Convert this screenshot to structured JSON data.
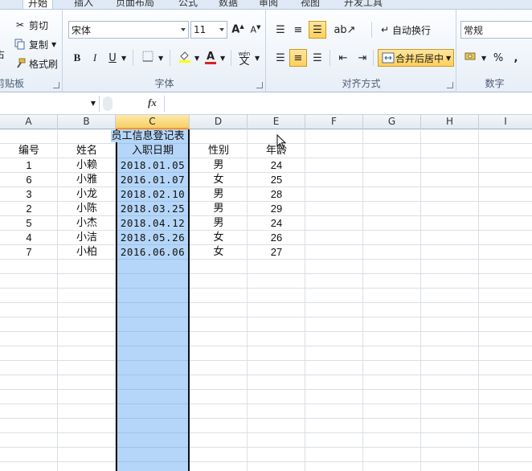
{
  "ribbon": {
    "tabs": [
      "开始",
      "插入",
      "页面布局",
      "公式",
      "数据",
      "审阅",
      "视图",
      "开发工具"
    ],
    "clipboard": {
      "cut": "剪切",
      "copy": "复制",
      "format_painter": "格式刷",
      "paste_partial": "占",
      "group_label": "剪贴板"
    },
    "font": {
      "font_name": "宋体",
      "font_size": "11",
      "bold": "B",
      "italic": "I",
      "underline": "U",
      "group_label": "字体",
      "phonetic": "wén"
    },
    "alignment": {
      "wrap_text": "自动换行",
      "merge_center": "合并后居中",
      "group_label": "对齐方式"
    },
    "number": {
      "format": "常规",
      "percent": "%",
      "comma": ",",
      "group_label": "数字"
    }
  },
  "formula_bar": {
    "fx": "fx",
    "value": ""
  },
  "grid": {
    "columns": [
      "A",
      "B",
      "C",
      "D",
      "E",
      "F",
      "G",
      "H",
      "I"
    ],
    "selected_column": "C",
    "title": "员工信息登记表",
    "headers": [
      "编号",
      "姓名",
      "入职日期",
      "性别",
      "年龄"
    ],
    "rows": [
      [
        "1",
        "小赖",
        "2018.01.05",
        "男",
        "24"
      ],
      [
        "6",
        "小雅",
        "2016.01.07",
        "女",
        "25"
      ],
      [
        "3",
        "小龙",
        "2018.02.10",
        "男",
        "28"
      ],
      [
        "2",
        "小陈",
        "2018.03.25",
        "男",
        "29"
      ],
      [
        "5",
        "小杰",
        "2018.04.12",
        "男",
        "24"
      ],
      [
        "4",
        "小洁",
        "2018.05.26",
        "女",
        "26"
      ],
      [
        "7",
        "小柏",
        "2016.06.06",
        "女",
        "27"
      ]
    ]
  },
  "colors": {
    "selection_fill": "#b5d6f8",
    "selected_header": "#f7cf63",
    "active_button": "#ffcf5c"
  }
}
